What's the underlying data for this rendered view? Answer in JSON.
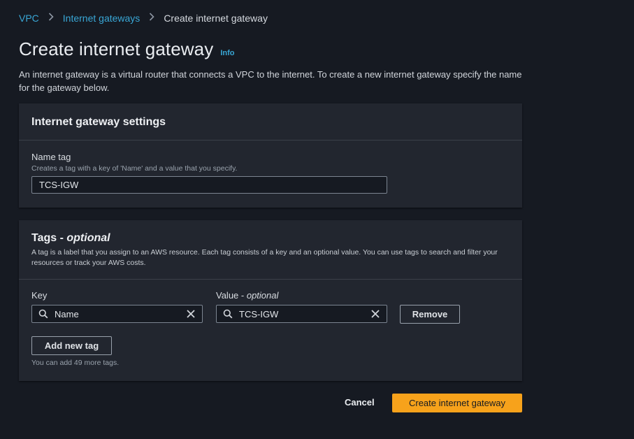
{
  "breadcrumb": {
    "root": "VPC",
    "parent": "Internet gateways",
    "current": "Create internet gateway"
  },
  "page": {
    "title": "Create internet gateway",
    "info_link": "Info",
    "description": "An internet gateway is a virtual router that connects a VPC to the internet. To create a new internet gateway specify the name for the gateway below."
  },
  "settings": {
    "heading": "Internet gateway settings",
    "name_tag_label": "Name tag",
    "name_tag_hint": "Creates a tag with a key of 'Name' and a value that you specify.",
    "name_tag_value": "TCS-IGW"
  },
  "tags": {
    "heading": "Tags - ",
    "heading_optional": "optional",
    "description": "A tag is a label that you assign to an AWS resource. Each tag consists of a key and an optional value. You can use tags to search and filter your resources or track your AWS costs.",
    "key_label": "Key",
    "value_label": "Value - ",
    "value_label_optional": "optional",
    "rows": [
      {
        "key": "Name",
        "value": "TCS-IGW"
      }
    ],
    "remove_label": "Remove",
    "add_label": "Add new tag",
    "remaining_hint": "You can add 49 more tags."
  },
  "footer": {
    "cancel_label": "Cancel",
    "submit_label": "Create internet gateway"
  },
  "colors": {
    "accent": "#f7a21b",
    "link": "#39a7d6",
    "background": "#161a22",
    "card": "#22262f"
  }
}
